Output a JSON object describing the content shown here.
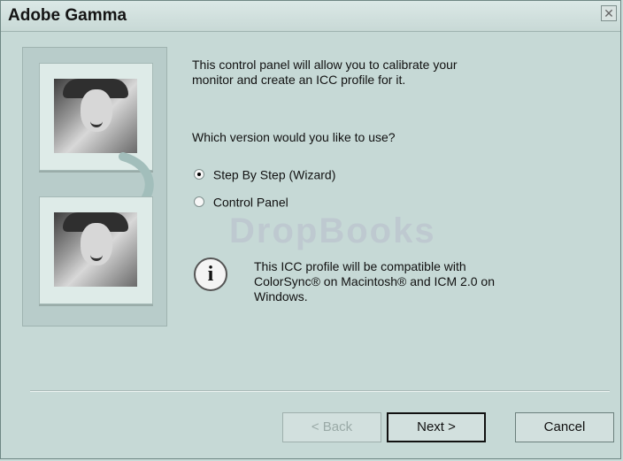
{
  "window": {
    "title": "Adobe Gamma"
  },
  "content": {
    "intro": "This control panel will allow you to calibrate your monitor and create an ICC profile for it.",
    "question": "Which version would you like to use?",
    "options": [
      {
        "label": "Step By Step (Wizard)",
        "selected": true
      },
      {
        "label": "Control Panel",
        "selected": false
      }
    ],
    "info_icon": "info-icon",
    "info_text": "This ICC profile will be compatible with ColorSync® on Macintosh® and ICM 2.0 on Windows."
  },
  "buttons": {
    "back": "< Back",
    "next": "Next >",
    "cancel": "Cancel"
  },
  "watermark": "DropBooks"
}
